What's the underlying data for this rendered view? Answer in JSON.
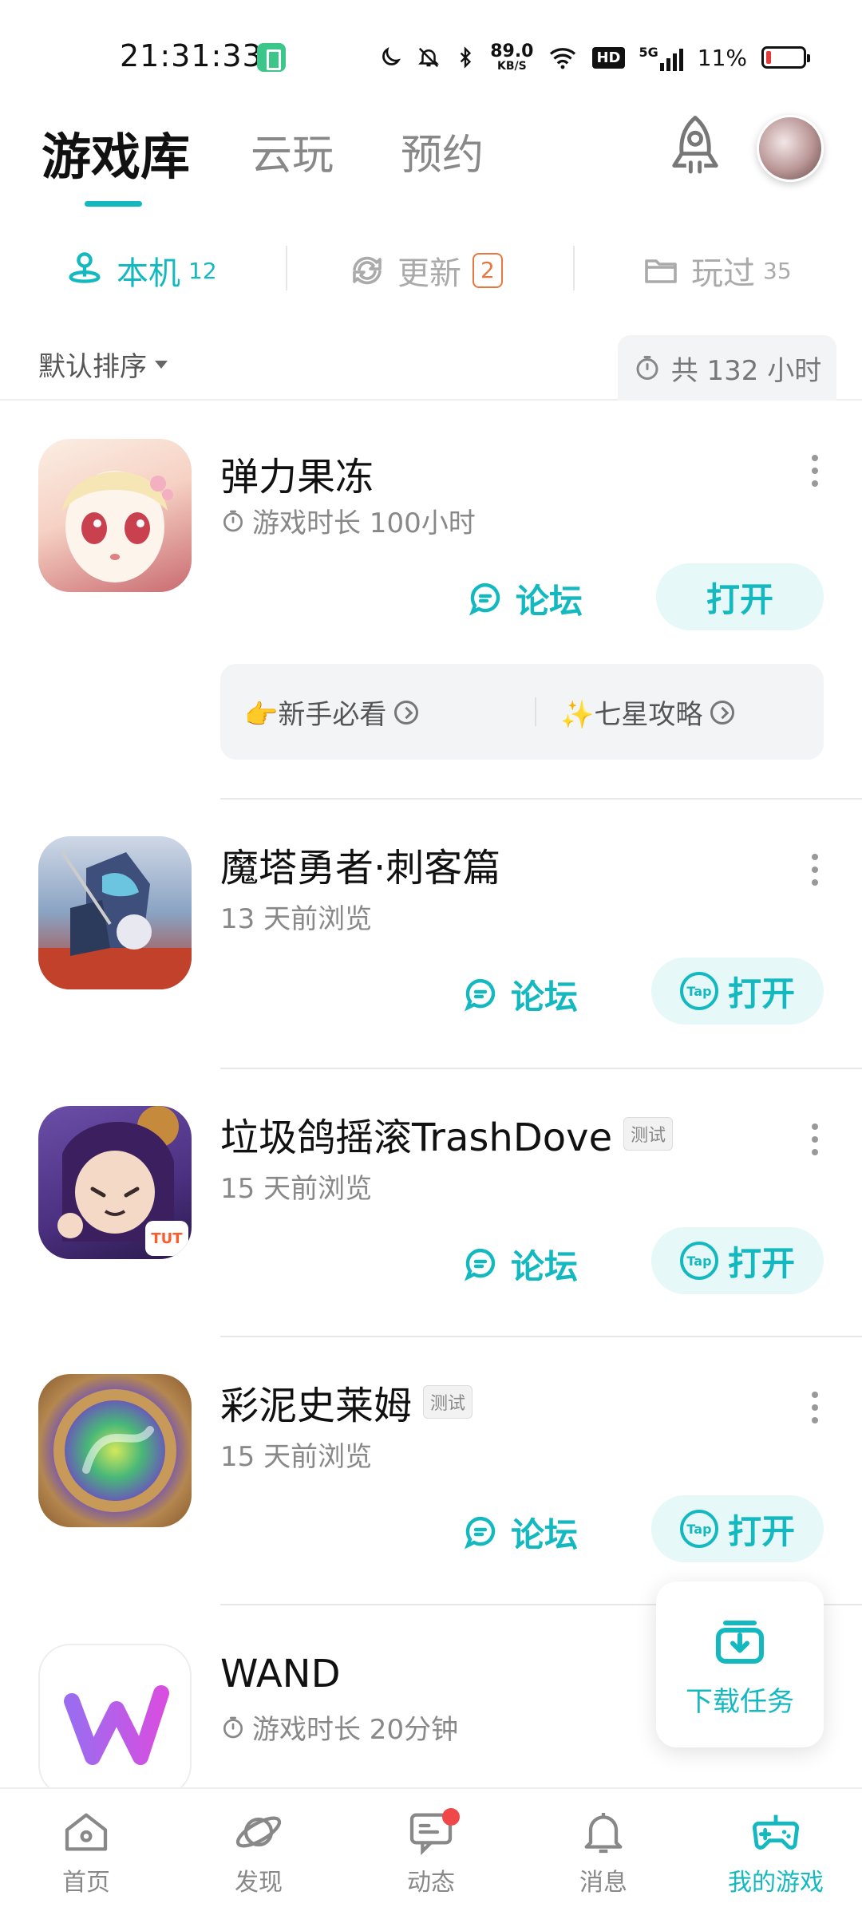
{
  "status_bar": {
    "time": "21:31:33",
    "net_speed_value": "89.0",
    "net_speed_unit": "KB/S",
    "hd_label": "HD",
    "network_type": "5G",
    "battery_percent": "11%"
  },
  "header": {
    "tabs": [
      "游戏库",
      "云玩",
      "预约"
    ],
    "active_tab_index": 0
  },
  "subtabs": [
    {
      "label": "本机",
      "count": "12",
      "active": true
    },
    {
      "label": "更新",
      "badge": "2",
      "active": false
    },
    {
      "label": "玩过",
      "count": "35",
      "active": false
    }
  ],
  "sort": {
    "label": "默认排序",
    "total_playtime": "共 132 小时"
  },
  "games": [
    {
      "title": "弹力果冻",
      "subtitle": "游戏时长 100小时",
      "forum_label": "论坛",
      "open_label": "打开",
      "guides": [
        "👉新手必看",
        "✨七星攻略"
      ]
    },
    {
      "title": "魔塔勇者·刺客篇",
      "subtitle": "13 天前浏览",
      "forum_label": "论坛",
      "open_label": "打开",
      "tap_label": "Tap"
    },
    {
      "title": "垃圾鸽摇滚TrashDove",
      "tag": "测试",
      "subtitle": "15 天前浏览",
      "forum_label": "论坛",
      "open_label": "打开",
      "tap_label": "Tap",
      "icon_badge": "TUT"
    },
    {
      "title": "彩泥史莱姆",
      "tag": "测试",
      "subtitle": "15 天前浏览",
      "forum_label": "论坛",
      "open_label": "打开",
      "tap_label": "Tap"
    },
    {
      "title": "WAND",
      "subtitle": "游戏时长 20分钟"
    }
  ],
  "download_card": {
    "label": "下载任务"
  },
  "bottom_nav": [
    {
      "label": "首页",
      "icon": "home-icon",
      "active": false
    },
    {
      "label": "发现",
      "icon": "planet-icon",
      "active": false
    },
    {
      "label": "动态",
      "icon": "chat-icon",
      "active": false,
      "has_dot": true
    },
    {
      "label": "消息",
      "icon": "bell-icon",
      "active": false
    },
    {
      "label": "我的游戏",
      "icon": "gamepad-icon",
      "active": true
    }
  ],
  "colors": {
    "accent": "#14b9c0",
    "update_badge": "#e8773f",
    "notification_dot": "#f04848"
  }
}
